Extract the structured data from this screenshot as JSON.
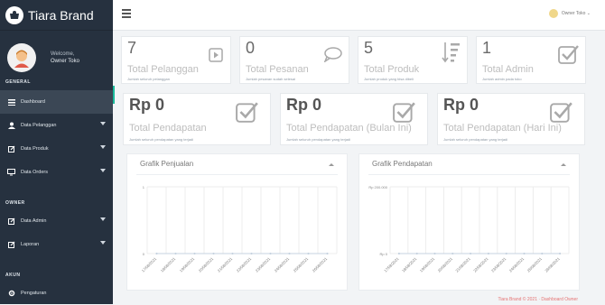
{
  "app": {
    "brand": "Tiara Brand"
  },
  "sidebar": {
    "welcome": "Welcome,",
    "user_name": "Owner Toko",
    "sections": {
      "general": "GENERAL",
      "owner": "OWNER",
      "akun": "AKUN"
    },
    "items": [
      {
        "label": "Dashboard",
        "icon": "bars-icon"
      },
      {
        "label": "Data Pelanggan",
        "icon": "user-icon"
      },
      {
        "label": "Data Produk",
        "icon": "edit-icon"
      },
      {
        "label": "Data Orders",
        "icon": "monitor-icon"
      },
      {
        "label": "Data Admin",
        "icon": "edit-icon"
      },
      {
        "label": "Laporan",
        "icon": "edit-icon"
      },
      {
        "label": "Pengaturan",
        "icon": "gear-icon"
      }
    ]
  },
  "topbar": {
    "user_label": "Owner Toko ⌄"
  },
  "stats": [
    {
      "value": "7",
      "title": "Total Pelanggan",
      "subtitle": "Jumlah seluruh pelanggan"
    },
    {
      "value": "0",
      "title": "Total Pesanan",
      "subtitle": "Jumlah pesanan sudah selesai"
    },
    {
      "value": "5",
      "title": "Total Produk",
      "subtitle": "Jumlah produk yang bisa dibeli"
    },
    {
      "value": "1",
      "title": "Total Admin",
      "subtitle": "Jumlah admin pada toko"
    }
  ],
  "revenue": [
    {
      "value": "Rp 0",
      "title": "Total Pendapatan",
      "subtitle": "Jumlah seluruh pendapatan yang terjadi"
    },
    {
      "value": "Rp 0",
      "title": "Total Pendapatan (Bulan Ini)",
      "subtitle": "Jumlah seluruh pendapatan yang terjadi"
    },
    {
      "value": "Rp 0",
      "title": "Total Pendapatan (Hari Ini)",
      "subtitle": "Jumlah seluruh pendapatan yang terjadi"
    }
  ],
  "chart_data": [
    {
      "type": "line",
      "title": "Grafik Penjualan",
      "ylim": [
        0,
        1
      ],
      "yticks": [
        "1",
        "0"
      ],
      "x": [
        "17/08/2021",
        "18/08/2021",
        "19/08/2021",
        "20/08/2021",
        "21/08/2021",
        "22/08/2021",
        "23/08/2021",
        "24/08/2021",
        "25/08/2021",
        "26/08/2021"
      ],
      "series": [
        {
          "values": [
            0,
            0,
            0,
            0,
            0,
            0,
            0,
            0,
            0,
            0
          ]
        }
      ],
      "grid": true
    },
    {
      "type": "line",
      "title": "Grafik Pendapatan",
      "ylim": [
        0,
        200000
      ],
      "yticks": [
        "Rp 200.000",
        "Rp 0"
      ],
      "x": [
        "17/08/2021",
        "18/08/2021",
        "19/08/2021",
        "20/08/2021",
        "21/08/2021",
        "22/08/2021",
        "23/08/2021",
        "24/08/2021",
        "25/08/2021",
        "26/08/2021"
      ],
      "series": [
        {
          "values": [
            0,
            0,
            0,
            0,
            0,
            0,
            0,
            0,
            0,
            0
          ]
        }
      ],
      "grid": true
    }
  ],
  "footer": {
    "text": "Tiara Brand © 2021 · Dashboard Owner"
  },
  "colors": {
    "sidebar": "#26313f",
    "active": "#3b4755",
    "accent_bar": "#1abb9c"
  }
}
